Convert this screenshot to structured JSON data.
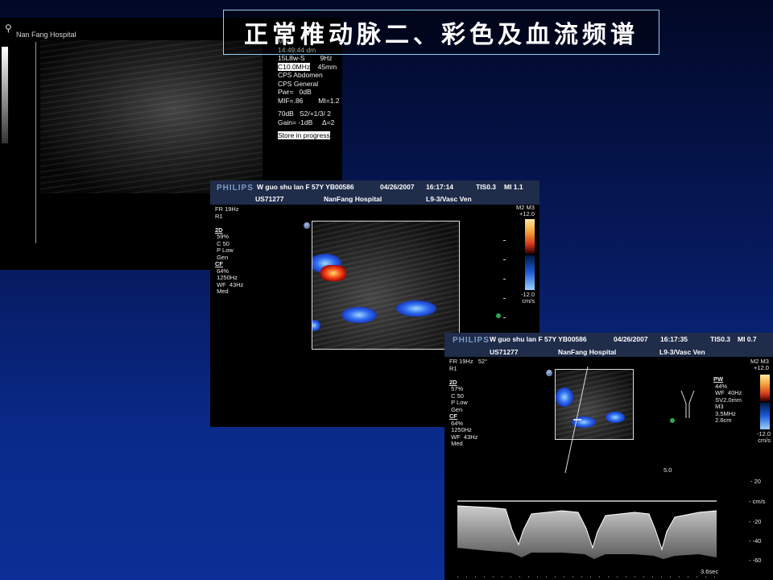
{
  "title": "正常椎动脉二、彩色及血流频谱",
  "panel1": {
    "logo_icon": "probe-icon",
    "hospital": "Nan Fang Hospital",
    "params": [
      {
        "text": "Mar",
        "highlight": false
      },
      {
        "text": "14:49:44 dm",
        "highlight": false
      },
      {
        "text": "15L8w-S        9Hz",
        "highlight": false
      },
      {
        "text": "C10.0MHz",
        "highlight": true,
        "suffix": "    45mm"
      },
      {
        "text": "CPS Abdomen",
        "highlight": false
      },
      {
        "text": "CPS General",
        "highlight": false
      },
      {
        "text": "Pwr=   0dB",
        "highlight": false
      },
      {
        "text": "MIF=.86        MI=1.2",
        "highlight": false
      },
      {
        "text": "",
        "highlight": false
      },
      {
        "text": "70dB   S2/+1/3/ 2",
        "highlight": false
      },
      {
        "text": "Gain= -1dB     Δ=2",
        "highlight": false
      },
      {
        "text": "",
        "highlight": false
      },
      {
        "text": "Store in progress",
        "highlight": true,
        "suffix": ""
      }
    ]
  },
  "panel2": {
    "brand": "PHILIPS",
    "patient": "W guo shu lan F 57Y YB00586",
    "date": "04/26/2007",
    "time": "16:17:14",
    "tis": "TIS0.3",
    "mi": "MI 1.1",
    "system": "US71277",
    "hospital": "NanFang Hospital",
    "probe": "L9-3/Vasc Ven",
    "left_params": [
      "FR 19Hz",
      "R1",
      "",
      "2D",
      " 59%",
      " C 50",
      " P Low",
      " Gen",
      "CF",
      " 64%",
      " 1250Hz",
      " WF  43Hz",
      " Med"
    ],
    "colorbar_top": "M2 M3\n+12.0",
    "colorbar_bottom": "-12.0\ncm/s"
  },
  "panel3": {
    "brand": "PHILIPS",
    "patient": "W guo shu lan F 57Y YB00586",
    "date": "04/26/2007",
    "time": "16:17:35",
    "tis": "TIS0.3",
    "mi": "MI 0.7",
    "system": "US71277",
    "hospital": "NanFang Hospital",
    "probe": "L9-3/Vasc Ven",
    "left_params": [
      "FR 19Hz   52°",
      "R1",
      "",
      "2D",
      " 57%",
      " C 50",
      " P Low",
      " Gen",
      "CF",
      " 64%",
      " 1250Hz",
      " WF  43Hz",
      " Med"
    ],
    "pw_params": [
      "PW",
      " 44%",
      " WF  40Hz",
      " SV2.0mm",
      " M3",
      " 3.5MHz",
      " 2.6cm"
    ],
    "colorbar_top": "M2 M3\n+12.0",
    "colorbar_bottom": "-12.0\ncm/s",
    "depth": "5.0",
    "scale_labels": [
      "20",
      "cm/s",
      "-20",
      "-40",
      "-60"
    ],
    "sweep": "3.6sec"
  }
}
